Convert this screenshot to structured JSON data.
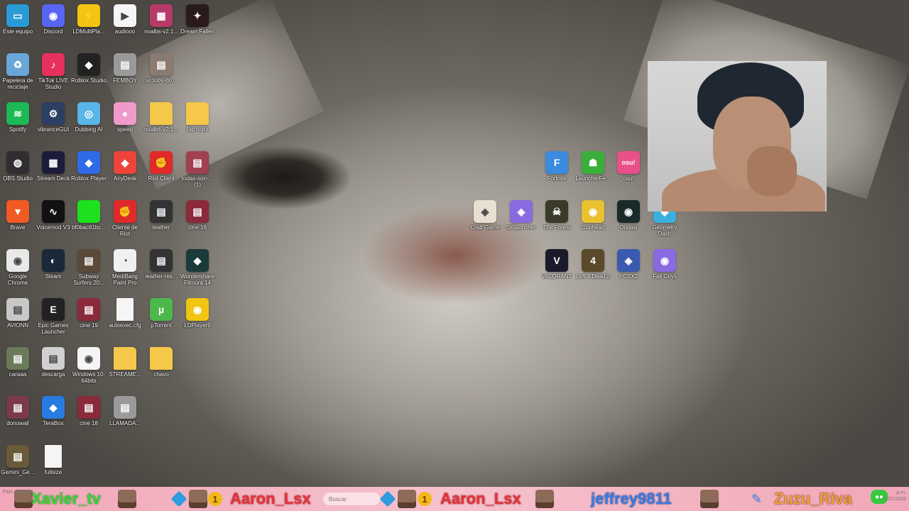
{
  "desktop": {
    "icons": [
      {
        "label": "Este equipo",
        "color": "#2a9bd6",
        "glyph": "▭",
        "icon": "computer-icon"
      },
      {
        "label": "Discord",
        "color": "#5865f2",
        "glyph": "◉",
        "icon": "discord-icon"
      },
      {
        "label": "LDMultiPla...",
        "color": "#f2c512",
        "glyph": "⚡",
        "icon": "ldmultiplayer-icon"
      },
      {
        "label": "audiooo",
        "color": "#f5f5f5",
        "glyph": "▶",
        "icon": "audio-file-icon"
      },
      {
        "label": "noalbs-v2.1...",
        "color": "#b83a6a",
        "glyph": "▦",
        "icon": "winrar-icon"
      },
      {
        "label": "Dream Fallen",
        "color": "#2a1a1a",
        "glyph": "✦",
        "icon": "dream-fallen-icon"
      },
      {
        "label": "Papelera de reciclaje",
        "color": "#6aa7d8",
        "glyph": "♻",
        "icon": "recycle-bin-icon"
      },
      {
        "label": "TikTok LIVE Studio",
        "color": "#e8305c",
        "glyph": "♪",
        "icon": "tiktok-icon"
      },
      {
        "label": "Roblox Studio",
        "color": "#222",
        "glyph": "◆",
        "icon": "roblox-studio-icon"
      },
      {
        "label": "FEMBOY",
        "color": "#9a9a9a",
        "glyph": "▤",
        "icon": "image-file-icon"
      },
      {
        "label": "scooby-do...",
        "color": "#8a7a70",
        "glyph": "▤",
        "icon": "image-file-icon"
      },
      {
        "label": "Spotify",
        "color": "#1db954",
        "glyph": "≋",
        "icon": "spotify-icon"
      },
      {
        "label": "vibranceGUI",
        "color": "#2d3e63",
        "glyph": "⚙",
        "icon": "gear-icon"
      },
      {
        "label": "Dubbing AI",
        "color": "#5ab6e8",
        "glyph": "◎",
        "icon": "dubbing-ai-icon"
      },
      {
        "label": "speed",
        "color": "#f09acb",
        "glyph": "●",
        "icon": "pig-icon"
      },
      {
        "label": "noalbs-v2.1...",
        "color": "#f5c84a",
        "glyph": "",
        "icon": "folder-icon"
      },
      {
        "label": "fap night",
        "color": "#f5c84a",
        "glyph": "",
        "icon": "folder-icon"
      },
      {
        "label": "OBS Studio",
        "color": "#302e31",
        "glyph": "◍",
        "icon": "obs-icon"
      },
      {
        "label": "Stream Deck",
        "color": "#1d1b3a",
        "glyph": "▦",
        "icon": "stream-deck-icon"
      },
      {
        "label": "Roblox Player",
        "color": "#2f6ae8",
        "glyph": "◆",
        "icon": "roblox-icon"
      },
      {
        "label": "AnyDesk",
        "color": "#ef443b",
        "glyph": "◆",
        "icon": "anydesk-icon"
      },
      {
        "label": "Riot Client",
        "color": "#e02a2a",
        "glyph": "✊",
        "icon": "riot-client-icon"
      },
      {
        "label": "todas-son-... (1)",
        "color": "#a04050",
        "glyph": "▤",
        "icon": "image-file-icon"
      },
      {
        "label": "Brave",
        "color": "#f25a24",
        "glyph": "▼",
        "icon": "brave-icon"
      },
      {
        "label": "Voicemod V3",
        "color": "#111",
        "glyph": "∿",
        "icon": "voicemod-icon"
      },
      {
        "label": "bf0bac61bc...",
        "color": "#1ee01e",
        "glyph": "",
        "icon": "image-file-icon"
      },
      {
        "label": "Cliente de Riot",
        "color": "#e02a2a",
        "glyph": "✊",
        "icon": "riot-client-icon"
      },
      {
        "label": "leather",
        "color": "#333",
        "glyph": "▤",
        "icon": "image-file-icon"
      },
      {
        "label": "cine 16",
        "color": "#8a2a3a",
        "glyph": "▤",
        "icon": "image-file-icon"
      },
      {
        "label": "Google Chrome",
        "color": "#e8e8e8",
        "glyph": "◉",
        "icon": "chrome-icon"
      },
      {
        "label": "Steam",
        "color": "#1b2838",
        "glyph": "◐",
        "icon": "steam-icon"
      },
      {
        "label": "Subway Surfers 20...",
        "color": "#5b4a3a",
        "glyph": "▤",
        "icon": "image-file-icon"
      },
      {
        "label": "MediBang Paint Pro",
        "color": "#f0f0f0",
        "glyph": "◔",
        "icon": "medibang-icon"
      },
      {
        "label": "leather-res...",
        "color": "#333",
        "glyph": "▤",
        "icon": "image-file-icon"
      },
      {
        "label": "Wondershare Filmora 14",
        "color": "#1b3a3a",
        "glyph": "◆",
        "icon": "filmora-icon"
      },
      {
        "label": "AVIONN",
        "color": "#c8c8c8",
        "glyph": "▤",
        "icon": "image-file-icon"
      },
      {
        "label": "Epic Games Launcher",
        "color": "#222",
        "glyph": "E",
        "icon": "epic-games-icon"
      },
      {
        "label": "cine 19",
        "color": "#8a2a3a",
        "glyph": "▤",
        "icon": "image-file-icon"
      },
      {
        "label": "autoexec.cfg",
        "color": "#f5f5f5",
        "glyph": "",
        "icon": "file-icon"
      },
      {
        "label": "µTorrent",
        "color": "#4cb84c",
        "glyph": "µ",
        "icon": "utorrent-icon"
      },
      {
        "label": "LDPlayer9",
        "color": "#f2c512",
        "glyph": "◉",
        "icon": "ldplayer-icon"
      },
      {
        "label": "caraaa",
        "color": "#6a7a5a",
        "glyph": "▤",
        "icon": "image-file-icon"
      },
      {
        "label": "descarga",
        "color": "#d0d0d0",
        "glyph": "▤",
        "icon": "image-file-icon"
      },
      {
        "label": "Windows 10-64bits",
        "color": "#f5f5f5",
        "glyph": "◉",
        "icon": "disc-image-icon"
      },
      {
        "label": "STREAME...",
        "color": "#f5c84a",
        "glyph": "",
        "icon": "folder-icon"
      },
      {
        "label": "chavo",
        "color": "#f5c84a",
        "glyph": "",
        "icon": "folder-icon"
      },
      {
        "label": "donowall",
        "color": "#7a3a4a",
        "glyph": "▤",
        "icon": "image-file-icon"
      },
      {
        "label": "TeraBox",
        "color": "#2a7be0",
        "glyph": "◆",
        "icon": "terabox-icon"
      },
      {
        "label": "cine 18",
        "color": "#8a2a3a",
        "glyph": "▤",
        "icon": "image-file-icon"
      },
      {
        "label": "LLAMADA...",
        "color": "#9a9a9a",
        "glyph": "▤",
        "icon": "image-file-icon"
      },
      {
        "label": "Gemini_Ge...",
        "color": "#6a5a3a",
        "glyph": "▤",
        "icon": "image-file-icon"
      },
      {
        "label": "fullsize",
        "color": "#f5f5f5",
        "glyph": "",
        "icon": "file-icon"
      },
      {
        "label": "Fortnite",
        "color": "#3a8ae0",
        "glyph": "F",
        "icon": "fortnite-icon"
      },
      {
        "label": "LauncherFe...",
        "color": "#3ab03a",
        "glyph": "☗",
        "icon": "creeper-icon"
      },
      {
        "label": "osu!",
        "color": "#e8508a",
        "glyph": "osu!",
        "icon": "osu-icon"
      },
      {
        "label": "Crab Game",
        "color": "#e8e0d0",
        "glyph": "◈",
        "icon": "crab-game-icon"
      },
      {
        "label": "SKlauncher",
        "color": "#8a6ae0",
        "glyph": "◈",
        "icon": "sklauncher-icon"
      },
      {
        "label": "The Forest",
        "color": "#3a3a2a",
        "glyph": "☠",
        "icon": "the-forest-icon"
      },
      {
        "label": "Cuphead",
        "color": "#e8c030",
        "glyph": "◉",
        "icon": "cuphead-icon"
      },
      {
        "label": "Outlast",
        "color": "#1a2a2a",
        "glyph": "◉",
        "icon": "outlast-icon"
      },
      {
        "label": "Geometry Dash",
        "color": "#3ab0e0",
        "glyph": "◆",
        "icon": "geometry-dash-icon"
      },
      {
        "label": "VALORANT",
        "color": "#1a1a2a",
        "glyph": "V",
        "icon": "valorant-icon"
      },
      {
        "label": "Left 4 Dead 2",
        "color": "#5a4a2a",
        "glyph": "4",
        "icon": "left4dead-icon"
      },
      {
        "label": "PCSX2",
        "color": "#3a5ab0",
        "glyph": "◈",
        "icon": "pcsx2-icon"
      },
      {
        "label": "Fall Guys",
        "color": "#8a6ae0",
        "glyph": "◉",
        "icon": "fall-guys-icon"
      }
    ]
  },
  "taskbar": {
    "weather": "Parc. soleado",
    "search_placeholder": "Buscar",
    "usernames": [
      "Xavier_tv",
      "Aaron_Lsx",
      "Aaron_Lsx",
      "jeffrey9811",
      "Zuzu_Riva"
    ],
    "badge_count": "1",
    "clock_time": "p.m.",
    "clock_date": "17/01/2026"
  },
  "colors": {
    "taskbar_bg": "#f1a7b8",
    "name_green": "#3ad43a",
    "name_red": "#e8323a",
    "name_blue": "#3c7be0"
  }
}
